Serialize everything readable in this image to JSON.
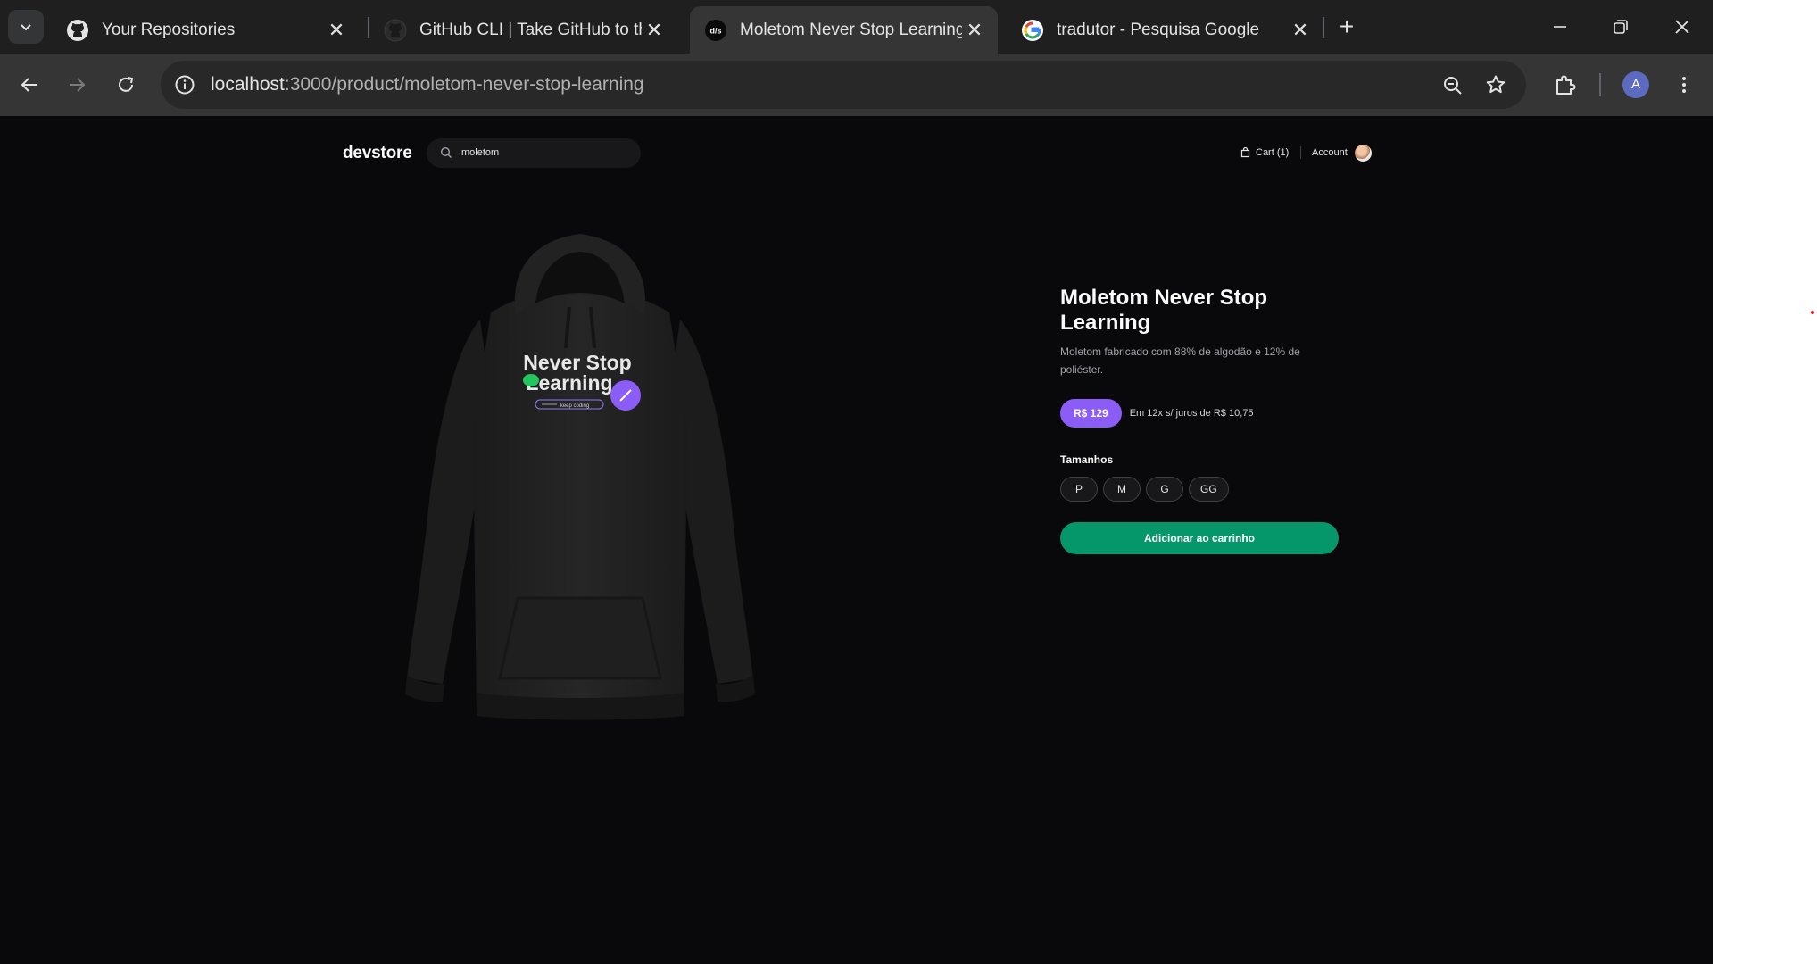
{
  "browser": {
    "tabs": [
      {
        "title": "Your Repositories",
        "favicon": "github-icon"
      },
      {
        "title": "GitHub CLI | Take GitHub to the",
        "favicon": "github-icon"
      },
      {
        "title": "Moletom Never Stop Learning |",
        "favicon": "devstore-icon",
        "favicon_text": "d/s"
      },
      {
        "title": "tradutor - Pesquisa Google",
        "favicon": "google-icon"
      }
    ],
    "url_host": "localhost",
    "url_path": ":3000/product/moletom-never-stop-learning",
    "profile_initial": "A"
  },
  "header": {
    "logo": "devstore",
    "search_value": "moletom",
    "cart_label": "Cart (1)",
    "account_label": "Account"
  },
  "product": {
    "title": "Moletom Never Stop Learning",
    "description": "Moletom fabricado com 88% de algodão e 12% de poliéster.",
    "price": "R$ 129",
    "installments": "Em 12x s/ juros de R$ 10,75",
    "sizes_label": "Tamanhos",
    "sizes": [
      "P",
      "M",
      "G",
      "GG"
    ],
    "add_to_cart": "Adicionar ao carrinho",
    "print_text_line1": "Never Stop",
    "print_text_line2": "Learning",
    "print_tag": "keep coding"
  },
  "colors": {
    "accent": "#8b5cf6",
    "add_button": "#059669",
    "page_bg": "#09090b"
  }
}
